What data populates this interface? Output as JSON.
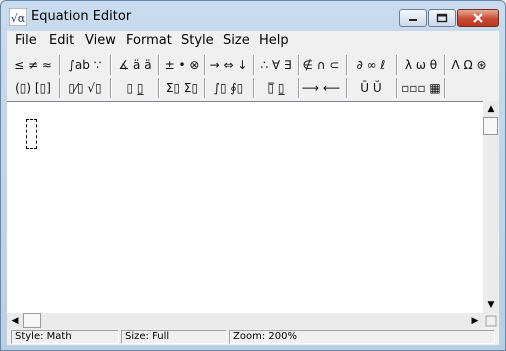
{
  "window": {
    "title": "Equation Editor",
    "app_icon_glyph": "√α"
  },
  "menu": [
    "File",
    "Edit",
    "View",
    "Format",
    "Style",
    "Size",
    "Help"
  ],
  "toolbar": {
    "row1": [
      {
        "name": "relational-symbols",
        "label": "≤ ≠ ≈"
      },
      {
        "name": "spaces-ellipses",
        "label": "∫ab ∵"
      },
      {
        "name": "embellishments",
        "label": "∡ ä ä"
      },
      {
        "name": "operator-symbols",
        "label": "± • ⊗"
      },
      {
        "name": "arrow-symbols",
        "label": "→ ⇔ ↓"
      },
      {
        "name": "logical-symbols",
        "label": "∴ ∀ ∃"
      },
      {
        "name": "set-theory-symbols",
        "label": "∉ ∩ ⊂"
      },
      {
        "name": "misc-symbols",
        "label": "∂ ∞ ℓ"
      },
      {
        "name": "greek-lowercase",
        "label": "λ ω θ"
      },
      {
        "name": "greek-uppercase",
        "label": "Λ Ω ⊛"
      }
    ],
    "row2": [
      {
        "name": "fence-templates",
        "label": "(▯) [▯]"
      },
      {
        "name": "fraction-radical-templates",
        "label": "▯⁄▯ √▯"
      },
      {
        "name": "subscript-superscript-templates",
        "label": "▯ ▯̲"
      },
      {
        "name": "summation-templates",
        "label": "Σ▯ Σ▯"
      },
      {
        "name": "integral-templates",
        "label": "∫▯ ∮▯"
      },
      {
        "name": "underbar-overbar-templates",
        "label": "▯̅ ▯̲"
      },
      {
        "name": "labeled-arrow-templates",
        "label": "⟶ ⟵"
      },
      {
        "name": "products-set-theory-templates",
        "label": "Ū Ŭ"
      },
      {
        "name": "matrix-templates",
        "label": "▫▫▫ ▦"
      }
    ]
  },
  "status": {
    "style": "Style: Math",
    "size": "Size: Full",
    "zoom": "Zoom: 200%"
  },
  "scrollbars": {
    "up": "▲",
    "down": "▼",
    "left": "◀",
    "right": "▶"
  }
}
